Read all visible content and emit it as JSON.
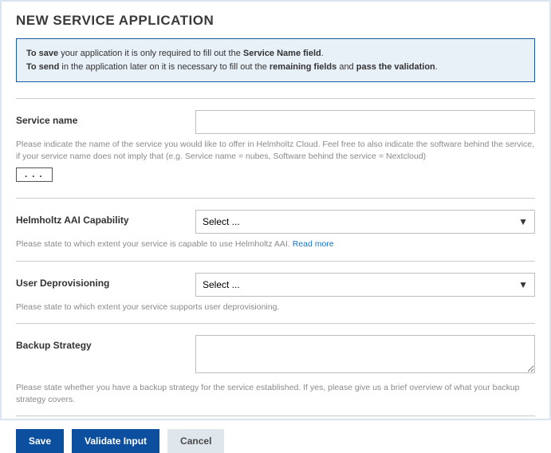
{
  "page": {
    "title": "NEW SERVICE APPLICATION"
  },
  "info": {
    "line1_prefix_bold": "To save",
    "line1_mid": " your application it is only required to fill out the ",
    "line1_bold2": "Service Name field",
    "line1_end": ".",
    "line2_prefix_bold": "To send",
    "line2_mid": " in the application later on it is necessary to fill out the ",
    "line2_bold2": "remaining fields",
    "line2_mid2": " and ",
    "line2_bold3": "pass the validation",
    "line2_end": "."
  },
  "fields": {
    "service_name": {
      "label": "Service name",
      "value": "",
      "help": "Please indicate the name of the service you would like to offer in Helmholtz Cloud. Feel free to also indicate the software behind the service, if your service name does not imply that (e.g. Service name = nubes, Software behind the service = Nextcloud)"
    },
    "collapse_toggle": "...",
    "aai": {
      "label": "Helmholtz AAI Capability",
      "selected": "Select ...",
      "help_text": "Please state to which extent your service is capable to use Helmholtz AAI. ",
      "help_link": "Read more"
    },
    "deprov": {
      "label": "User Deprovisioning",
      "selected": "Select ...",
      "help": "Please state to which extent your service supports user deprovisioning."
    },
    "backup": {
      "label": "Backup Strategy",
      "value": "",
      "help": "Please state whether you have a backup strategy for the service established. If yes, please give us a brief overview of what your backup strategy covers."
    }
  },
  "buttons": {
    "save": "Save",
    "validate": "Validate Input",
    "cancel": "Cancel"
  }
}
